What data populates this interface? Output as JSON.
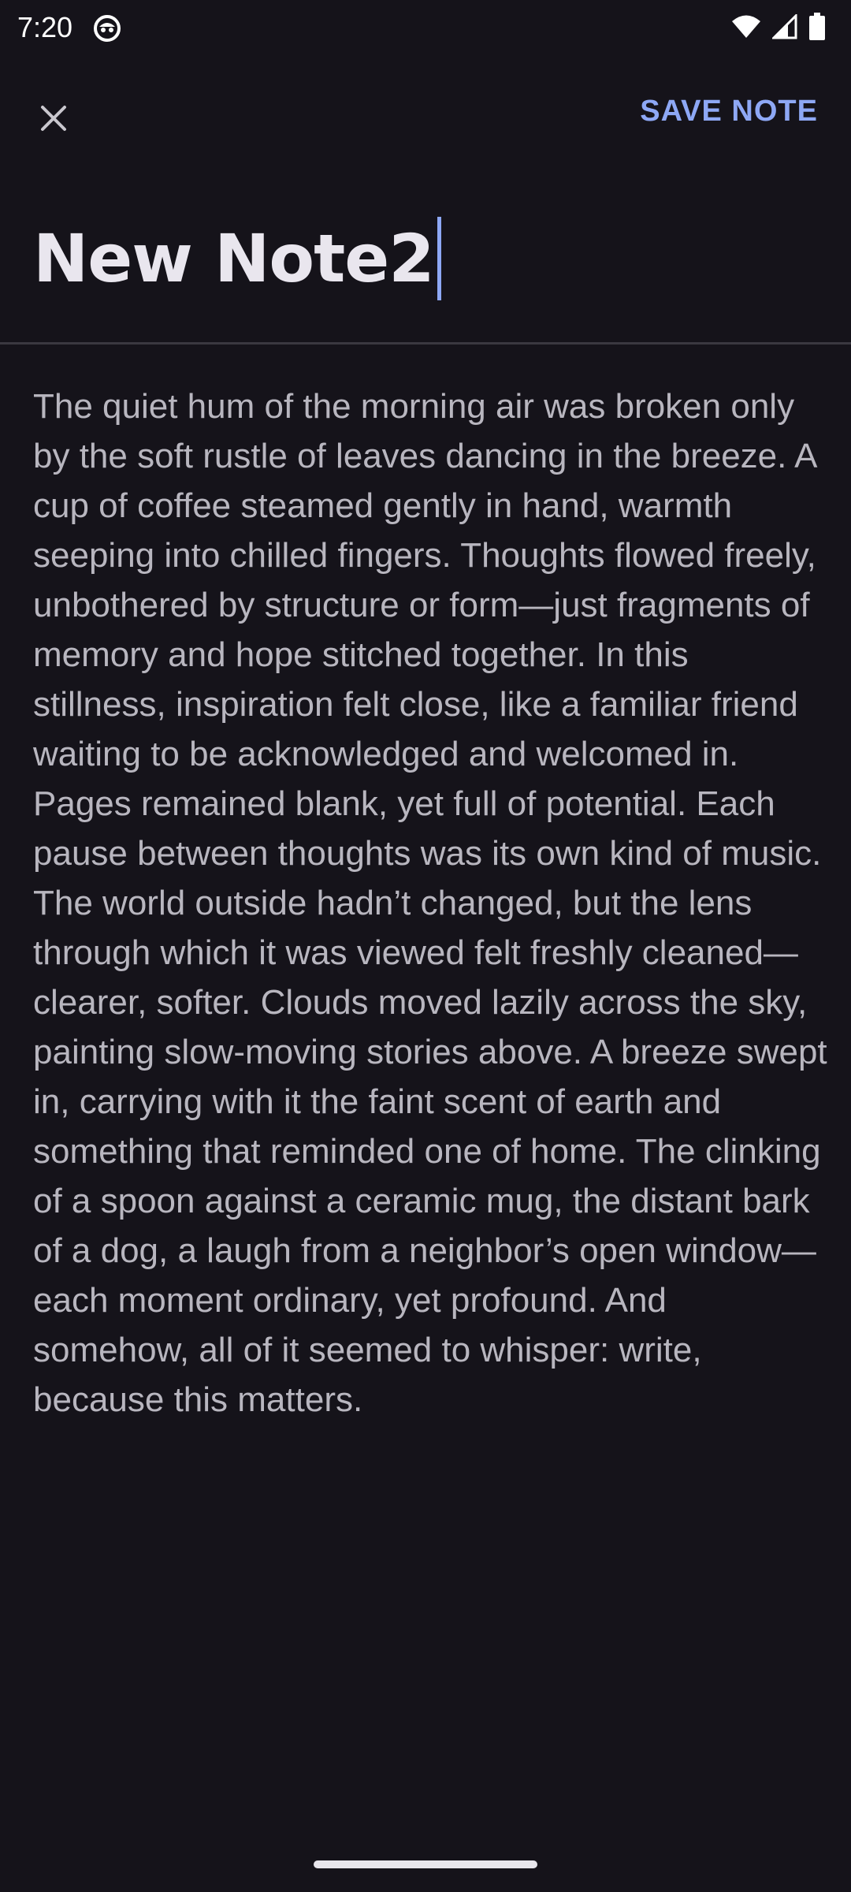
{
  "status_bar": {
    "time": "7:20",
    "icons": [
      "app-notification-icon",
      "wifi-icon",
      "cellular-signal-icon",
      "battery-icon"
    ]
  },
  "toolbar": {
    "close_icon": "close-icon",
    "save_label": "SAVE NOTE"
  },
  "note": {
    "title": "New Note2",
    "body": "The quiet hum of the morning air was broken only by the soft rustle of leaves dancing in the breeze. A cup of coffee steamed gently in hand, warmth seeping into chilled fingers. Thoughts flowed freely, unbothered by structure or form—just fragments of memory and hope stitched together. In this stillness, inspiration felt close, like a familiar friend waiting to be acknowledged and welcomed in. Pages remained blank, yet full of potential. Each pause between thoughts was its own kind of music. The world outside hadn’t changed, but the lens through which it was viewed felt freshly cleaned—clearer, softer. Clouds moved lazily across the sky, painting slow-moving stories above. A breeze swept in, carrying with it the faint scent of earth and something that reminded one of home. The clinking of a spoon against a ceramic mug, the distant bark of a dog, a laugh from a neighbor’s open window—each moment ordinary, yet profound. And somehow, all of it seemed to whisper: write, because this matters."
  },
  "colors": {
    "background": "#15131a",
    "accent": "#8ea8f5",
    "title_text": "#e9e6ee",
    "body_text": "#b8b6bf",
    "divider": "#3a3840"
  }
}
